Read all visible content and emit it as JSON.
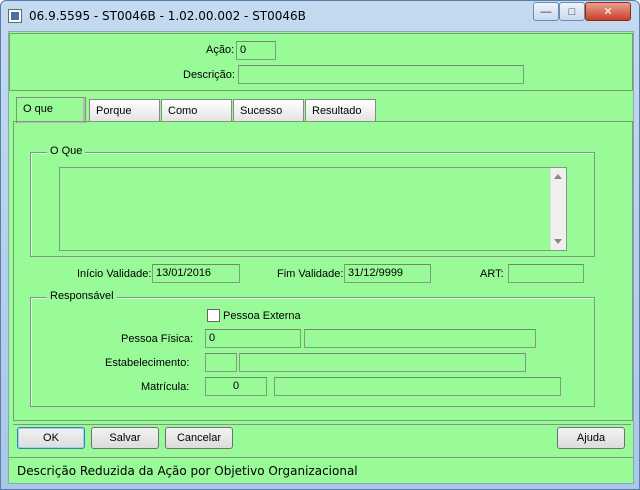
{
  "window": {
    "title": "06.9.5595 - ST0046B - 1.02.00.002 - ST0046B",
    "minimize_glyph": "—",
    "maximize_glyph": "□",
    "close_glyph": "✕"
  },
  "header": {
    "acao_label": "Ação:",
    "acao_value": "0",
    "descricao_label": "Descrição:",
    "descricao_value": ""
  },
  "tabs": [
    {
      "label": "O que",
      "active": true
    },
    {
      "label": "Porque",
      "active": false
    },
    {
      "label": "Como",
      "active": false
    },
    {
      "label": "Sucesso",
      "active": false
    },
    {
      "label": "Resultado",
      "active": false
    }
  ],
  "oque": {
    "group_title": "O Que",
    "text": "",
    "inicio_label": "Início Validade:",
    "inicio_value": "13/01/2016",
    "fim_label": "Fim Validade:",
    "fim_value": "31/12/9999",
    "art_label": "ART:",
    "art_value": ""
  },
  "responsavel": {
    "group_title": "Responsável",
    "pessoa_externa_label": "Pessoa Externa",
    "pessoa_externa_checked": false,
    "pessoa_fisica_label": "Pessoa Física:",
    "pessoa_fisica_code": "0",
    "pessoa_fisica_name": "",
    "estabelecimento_label": "Estabelecimento:",
    "estabelecimento_code": "",
    "estabelecimento_name": "",
    "matricula_label": "Matrícula:",
    "matricula_code": "0",
    "matricula_name": ""
  },
  "buttons": {
    "ok": "OK",
    "salvar": "Salvar",
    "cancelar": "Cancelar",
    "ajuda": "Ajuda"
  },
  "status_bar": {
    "text": "Descrição Reduzida da Ação por Objetivo Organizacional"
  },
  "colors": {
    "panel": "#98fb98"
  }
}
